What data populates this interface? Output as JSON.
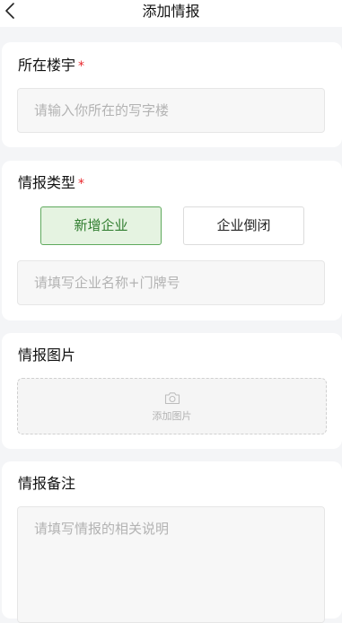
{
  "nav": {
    "title": "添加情报"
  },
  "building": {
    "label": "所在楼宇",
    "required_mark": "*",
    "placeholder": "请输入你所在的写字楼"
  },
  "intel_type": {
    "label": "情报类型",
    "required_mark": "*",
    "options": [
      {
        "label": "新增企业",
        "selected": true
      },
      {
        "label": "企业倒闭",
        "selected": false
      }
    ],
    "name_placeholder": "请填写企业名称+门牌号"
  },
  "photos": {
    "label": "情报图片",
    "upload_text": "添加图片"
  },
  "notes": {
    "label": "情报备注",
    "placeholder": "请填写情报的相关说明"
  },
  "colors": {
    "accent": "#5fa95d",
    "accent_bg": "#e5f3e1",
    "required": "#e8262b",
    "page_bg": "#f4f5f7"
  }
}
